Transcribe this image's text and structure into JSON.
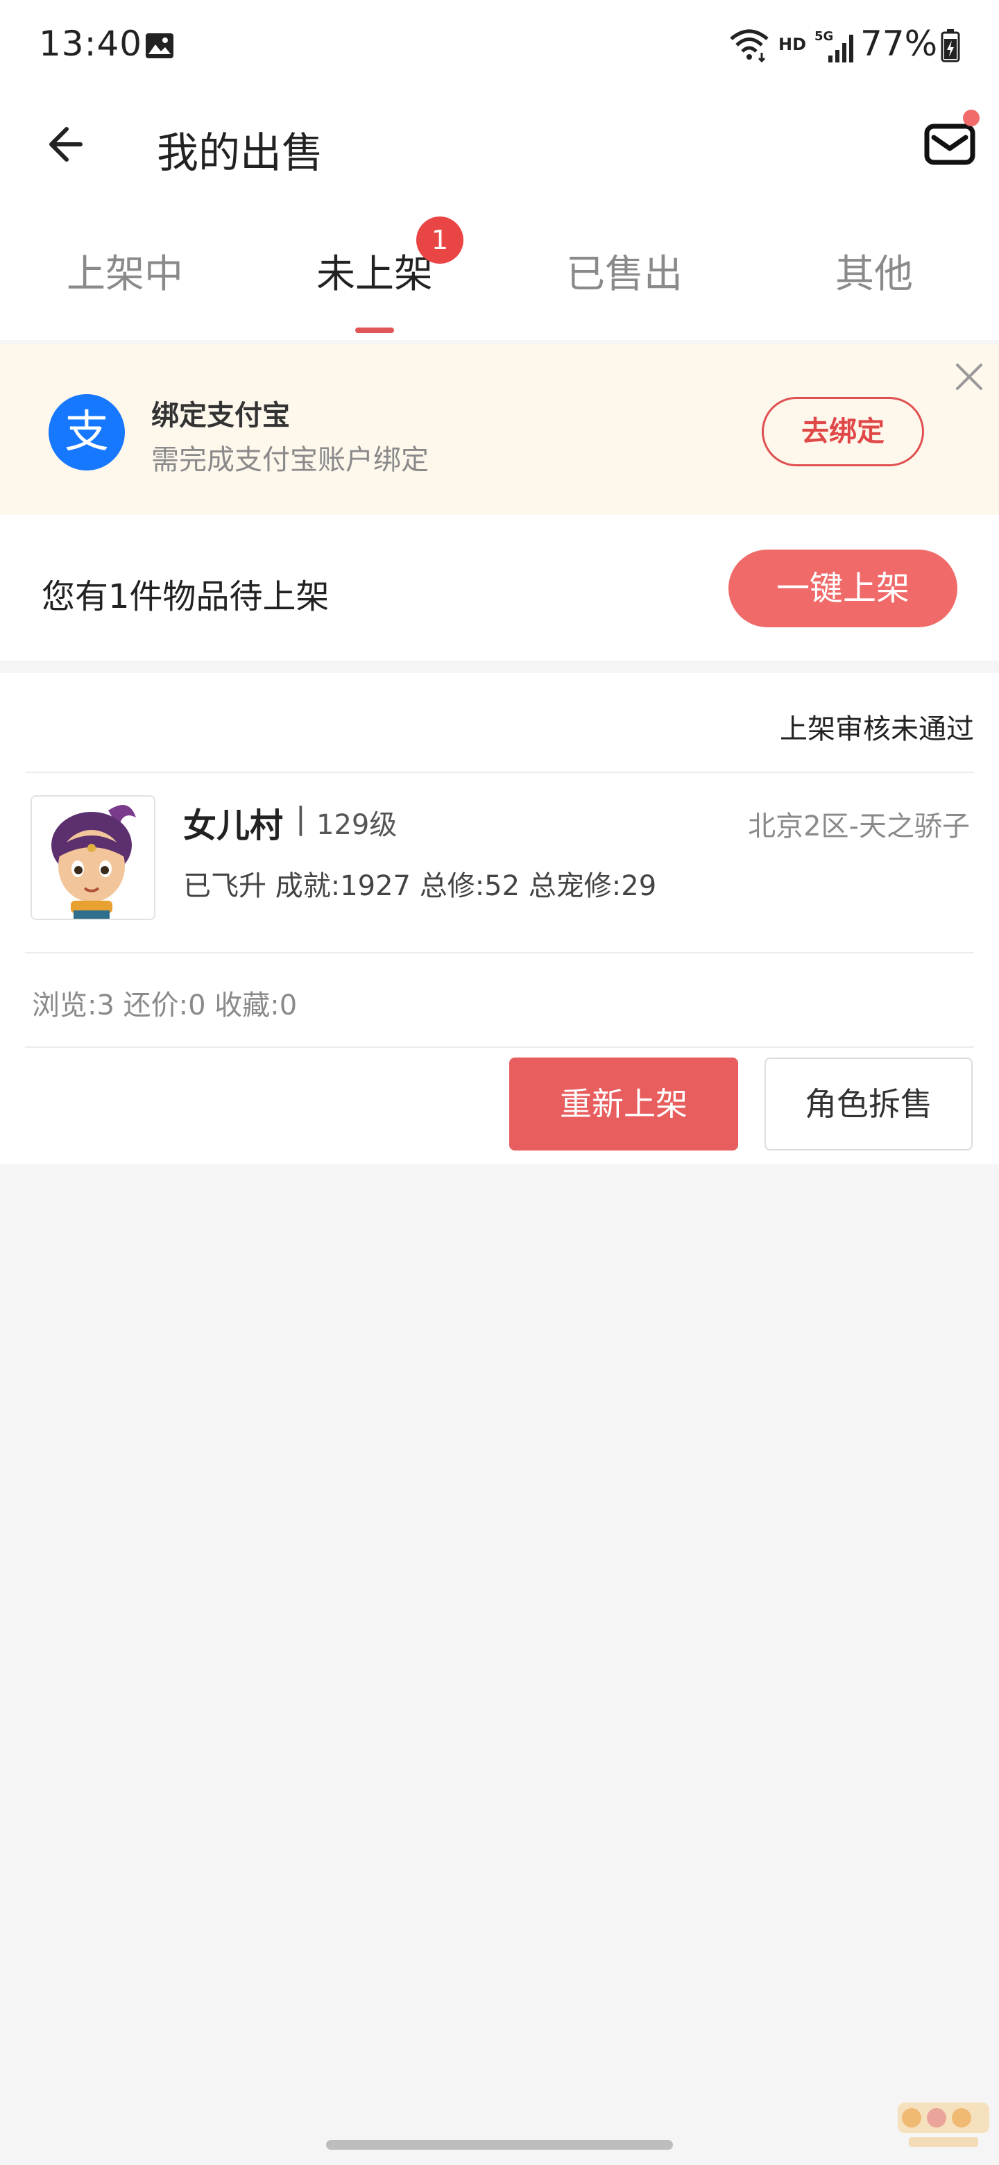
{
  "status_bar": {
    "time": "13:40",
    "network": "HD",
    "battery": "77%",
    "icons": [
      "gallery-icon",
      "wifi-icon",
      "signal-5g-icon",
      "battery-charging-icon"
    ]
  },
  "header": {
    "title": "我的出售",
    "back_icon": "arrow-left-icon",
    "mail_icon": "mail-icon"
  },
  "tabs": [
    {
      "label": "上架中",
      "active": false
    },
    {
      "label": "未上架",
      "active": true,
      "badge": "1"
    },
    {
      "label": "已售出",
      "active": false
    },
    {
      "label": "其他",
      "active": false
    }
  ],
  "banner": {
    "logo_char": "支",
    "title": "绑定支付宝",
    "subtitle": "需完成支付宝账户绑定",
    "button": "去绑定"
  },
  "pending": {
    "text": "您有1件物品待上架",
    "button": "一键上架"
  },
  "item": {
    "review_status": "上架审核未通过",
    "role_name": "女儿村",
    "separator": "|",
    "level": "129级",
    "server": "北京2区-天之骄子",
    "stats": "已飞升 成就:1927 总修:52 总宠修:29",
    "counts": "浏览:3 还价:0 收藏:0",
    "relist_button": "重新上架",
    "split_sell_button": "角色拆售"
  },
  "colors": {
    "accent": "#f06a69",
    "badge": "#ea4545",
    "alipay_blue": "#1677ff",
    "banner_bg": "#fdf7ec"
  }
}
